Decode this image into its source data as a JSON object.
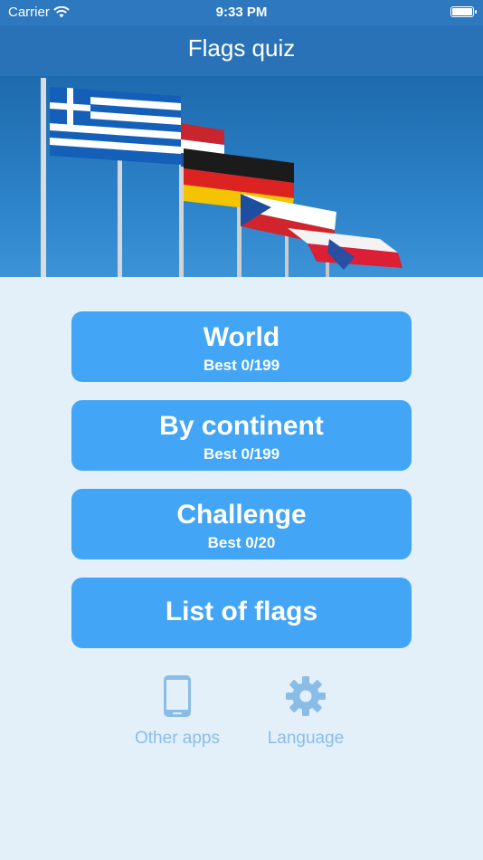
{
  "status_bar": {
    "carrier": "Carrier",
    "time": "9:33 PM",
    "icons": [
      "wifi-icon",
      "battery-icon"
    ]
  },
  "navbar": {
    "title": "Flags quiz"
  },
  "hero": {
    "image": "flags-banner",
    "flags": [
      "Greece",
      "Netherlands",
      "Germany",
      "Czech Republic",
      "Poland"
    ]
  },
  "menu": [
    {
      "title": "World",
      "subtitle": "Best 0/199"
    },
    {
      "title": "By continent",
      "subtitle": "Best 0/199"
    },
    {
      "title": "Challenge",
      "subtitle": "Best 0/20"
    },
    {
      "title": "List of flags",
      "subtitle": ""
    }
  ],
  "bottom": {
    "other_apps": {
      "label": "Other apps",
      "icon": "phone-icon"
    },
    "language": {
      "label": "Language",
      "icon": "gear-icon"
    }
  },
  "colors": {
    "background": "#e3f0fa",
    "navbar": "#2a72b8",
    "button": "#42a5f5",
    "secondary_text": "#89bde8"
  }
}
